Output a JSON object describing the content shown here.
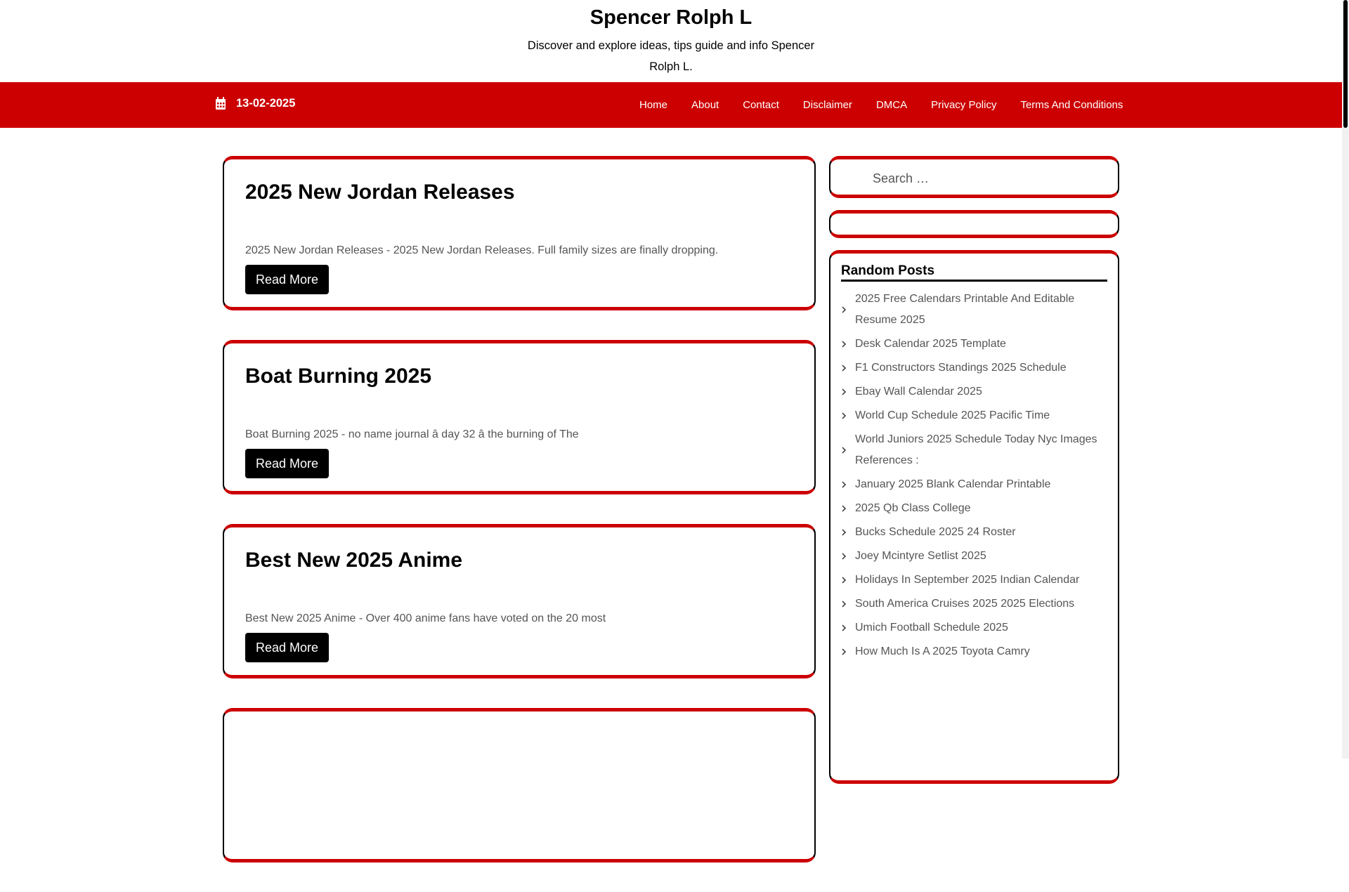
{
  "header": {
    "title": "Spencer Rolph L",
    "tagline": "Discover and explore ideas, tips guide and info Spencer Rolph L."
  },
  "navbar": {
    "date": "13-02-2025",
    "items": [
      "Home",
      "About",
      "Contact",
      "Disclaimer",
      "DMCA",
      "Privacy Policy",
      "Terms And Conditions"
    ]
  },
  "posts": [
    {
      "title": "2025 New Jordan Releases",
      "excerpt": "2025 New Jordan Releases - 2025 New Jordan Releases. Full family sizes are finally dropping.",
      "button": "Read More"
    },
    {
      "title": "Boat Burning 2025",
      "excerpt": "Boat Burning 2025 - no name journal â day 32 â the burning of The",
      "button": "Read More"
    },
    {
      "title": "Best New 2025 Anime",
      "excerpt": "Best New 2025 Anime - Over 400 anime fans have voted on the 20 most",
      "button": "Read More"
    }
  ],
  "sidebar": {
    "search_placeholder": "Search …",
    "random_title": "Random Posts",
    "random_posts": [
      "2025 Free Calendars Printable And Editable Resume 2025",
      "Desk Calendar 2025 Template",
      "F1 Constructors Standings 2025 Schedule",
      "Ebay Wall Calendar 2025",
      "World Cup Schedule 2025 Pacific Time",
      "World Juniors 2025 Schedule Today Nyc Images References :",
      "January 2025 Blank Calendar Printable",
      "2025 Qb Class College",
      "Bucks Schedule 2025 24 Roster",
      "Joey Mcintyre Setlist 2025",
      "Holidays In September 2025 Indian Calendar",
      "South America Cruises 2025 2025 Elections",
      "Umich Football Schedule 2025",
      "How Much Is A 2025 Toyota Camry"
    ]
  },
  "icons": {
    "calendar": "calendar-icon",
    "chevron": "chevron-right-icon"
  },
  "colors": {
    "brand_red": "#cc0000",
    "button_black": "#000000"
  }
}
